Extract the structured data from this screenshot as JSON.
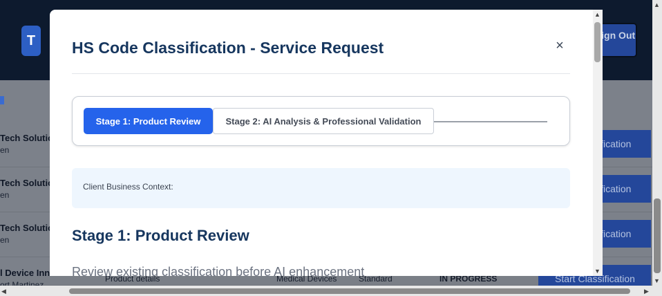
{
  "background": {
    "avatar_letter": "T",
    "signout_label": "Sign Out",
    "rows": [
      {
        "name": "Tech Solution",
        "sub": "en",
        "action": "ification"
      },
      {
        "name": "Tech Solution",
        "sub": "en",
        "action": "ification"
      },
      {
        "name": "Tech Solution",
        "sub": "en",
        "action": "ification"
      },
      {
        "name": "l Device Inno",
        "sub": "ort Martinez",
        "action": "Start Classification"
      }
    ],
    "last_row_cells": {
      "description": "Product details",
      "category": "Medical Devices",
      "tier": "Standard",
      "status": "IN PROGRESS"
    }
  },
  "modal": {
    "title": "HS Code Classification - Service Request",
    "close_symbol": "×",
    "steps": [
      {
        "label": "Stage 1: Product Review",
        "active": true
      },
      {
        "label": "Stage 2: AI Analysis & Professional Validation",
        "active": false
      }
    ],
    "context_label": "Client Business Context:",
    "stage_heading": "Stage 1: Product Review",
    "stage_description": "Review existing classification before AI enhancement"
  },
  "colors": {
    "primary": "#2563eb",
    "title": "#16365e",
    "header_bg": "#0d1a2e"
  }
}
